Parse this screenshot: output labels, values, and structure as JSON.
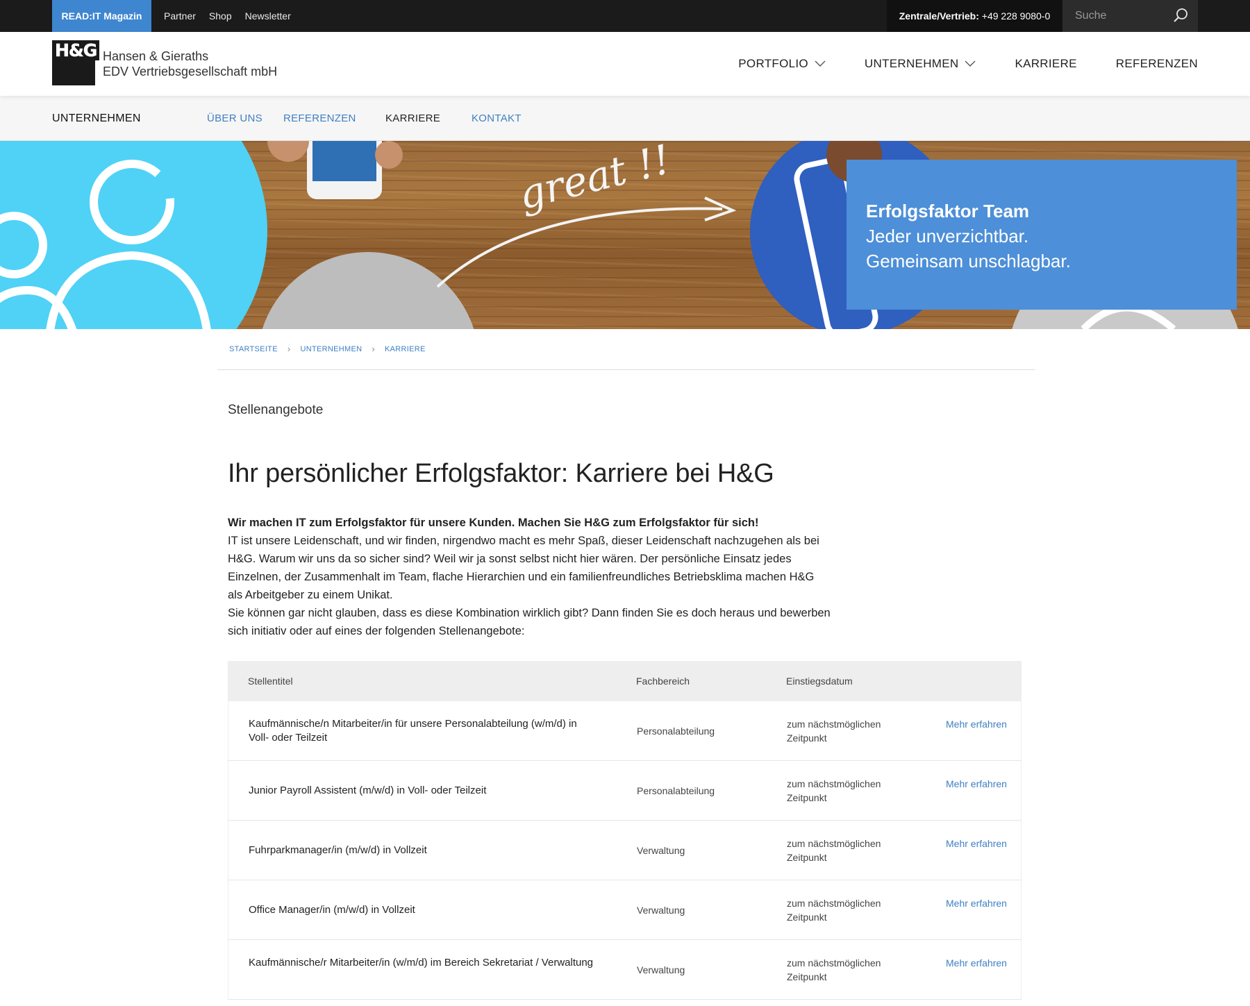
{
  "topbar": {
    "magazin_label": "READ:IT Magazin",
    "links": [
      "Partner",
      "Shop",
      "Newsletter"
    ],
    "phone_label": "Zentrale/Vertrieb:",
    "phone_number": "+49 228 9080-0",
    "search_placeholder": "Suche"
  },
  "header": {
    "logo_text": "H&G",
    "company_line1": "Hansen & Gieraths",
    "company_line2": "EDV Vertriebsgesellschaft mbH",
    "nav": [
      {
        "label": "PORTFOLIO",
        "dropdown": true
      },
      {
        "label": "UNTERNEHMEN",
        "dropdown": true
      },
      {
        "label": "KARRIERE",
        "dropdown": false
      },
      {
        "label": "REFERENZEN",
        "dropdown": false
      }
    ]
  },
  "subnav": {
    "section": "UNTERNEHMEN",
    "items": [
      {
        "label": "ÜBER UNS",
        "active": false
      },
      {
        "label": "REFERENZEN",
        "active": false
      },
      {
        "label": "KARRIERE",
        "active": true
      },
      {
        "label": "KONTAKT",
        "active": false
      }
    ]
  },
  "hero": {
    "chalk_text": "great !!",
    "headline": "Erfolgsfaktor Team",
    "line1": "Jeder unverzichtbar.",
    "line2": "Gemeinsam unschlagbar."
  },
  "breadcrumb": [
    "STARTSEITE",
    "UNTERNEHMEN",
    "KARRIERE"
  ],
  "content": {
    "kicker": "Stellenangebote",
    "title": "Ihr persönlicher Erfolgsfaktor: Karriere bei H&G",
    "lead": "Wir machen IT zum Erfolgsfaktor für unsere Kunden. Machen Sie H&G zum Erfolgsfaktor für sich!",
    "para1": "IT ist unsere Leidenschaft, und wir finden, nirgendwo macht es mehr Spaß, dieser Leidenschaft nachzugehen als bei H&G. Warum wir uns da so sicher sind? Weil wir ja sonst selbst nicht hier wären. Der persönliche Einsatz jedes Einzelnen, der Zusammenhalt im Team, flache Hierarchien und ein familienfreundliches Betriebsklima machen H&G als Arbeitgeber zu einem Unikat.",
    "para2": "Sie können gar nicht glauben, dass es diese Kombination wirklich gibt? Dann finden Sie es doch heraus und bewerben sich initiativ oder auf eines der folgenden Stellenangebote:"
  },
  "jobs": {
    "headers": {
      "title": "Stellentitel",
      "area": "Fachbereich",
      "date": "Einstiegsdatum"
    },
    "rows": [
      {
        "title": "Kaufmännische/n Mitarbeiter/in für unsere Personalabteilung (w/m/d) in Voll- oder Teilzeit",
        "area": "Personalabteilung",
        "date": "zum nächstmöglichen Zeitpunkt",
        "link": "Mehr erfahren"
      },
      {
        "title": "Junior Payroll Assistent (m/w/d) in Voll- oder Teilzeit",
        "area": "Personalabteilung",
        "date": "zum nächstmöglichen Zeitpunkt",
        "link": "Mehr erfahren"
      },
      {
        "title": "Fuhrparkmanager/in (m/w/d) in Vollzeit",
        "area": "Verwaltung",
        "date": "zum nächstmöglichen Zeitpunkt",
        "link": "Mehr erfahren"
      },
      {
        "title": "Office Manager/in (m/w/d) in Vollzeit",
        "area": "Verwaltung",
        "date": "zum nächstmöglichen Zeitpunkt",
        "link": "Mehr erfahren"
      },
      {
        "title": "Kaufmännische/r Mitarbeiter/in (w/m/d) im Bereich Sekretariat / Verwaltung",
        "area": "Verwaltung",
        "date": "zum nächstmöglichen Zeitpunkt",
        "link": "Mehr erfahren"
      }
    ]
  },
  "colors": {
    "accent": "#3f86d0",
    "link": "#3f7fc4",
    "dark": "#1b1b1b",
    "hero_box": "#4d8fd8"
  }
}
